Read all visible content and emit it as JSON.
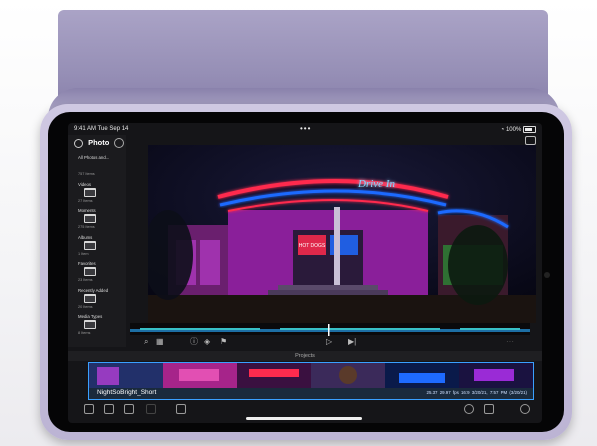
{
  "status_bar": {
    "time": "9:41 AM  Tue Sep 14",
    "dots": "•••",
    "battery": "100%"
  },
  "sidebar": {
    "title": "Photo",
    "items": [
      {
        "label": "All Photos and...",
        "count": "757 Items"
      },
      {
        "label": "Videos",
        "count": "27 Items"
      },
      {
        "label": "Moments",
        "count": "275 Items"
      },
      {
        "label": "Albums",
        "count": "1 Item"
      },
      {
        "label": "Favorites",
        "count": "23 Items"
      },
      {
        "label": "Recently Added",
        "count": "20 Items"
      },
      {
        "label": "Media Types",
        "count": "8 Items"
      }
    ]
  },
  "viewer": {
    "sign_text": "Drive In",
    "small_sign": "HOT DOGS"
  },
  "projects_label": "Projects",
  "clip": {
    "name": "NightSoBright_Short",
    "meta": "25.37  29.97 fps  16:9  3/20/21, 7:57 PM  (3/20/21)"
  },
  "colors": {
    "accent": "#3aa0ff",
    "neon_red": "#ff2b4e",
    "neon_blue": "#1e6bff",
    "neon_magenta": "#d62bd6",
    "device": "#bdb5d6"
  }
}
